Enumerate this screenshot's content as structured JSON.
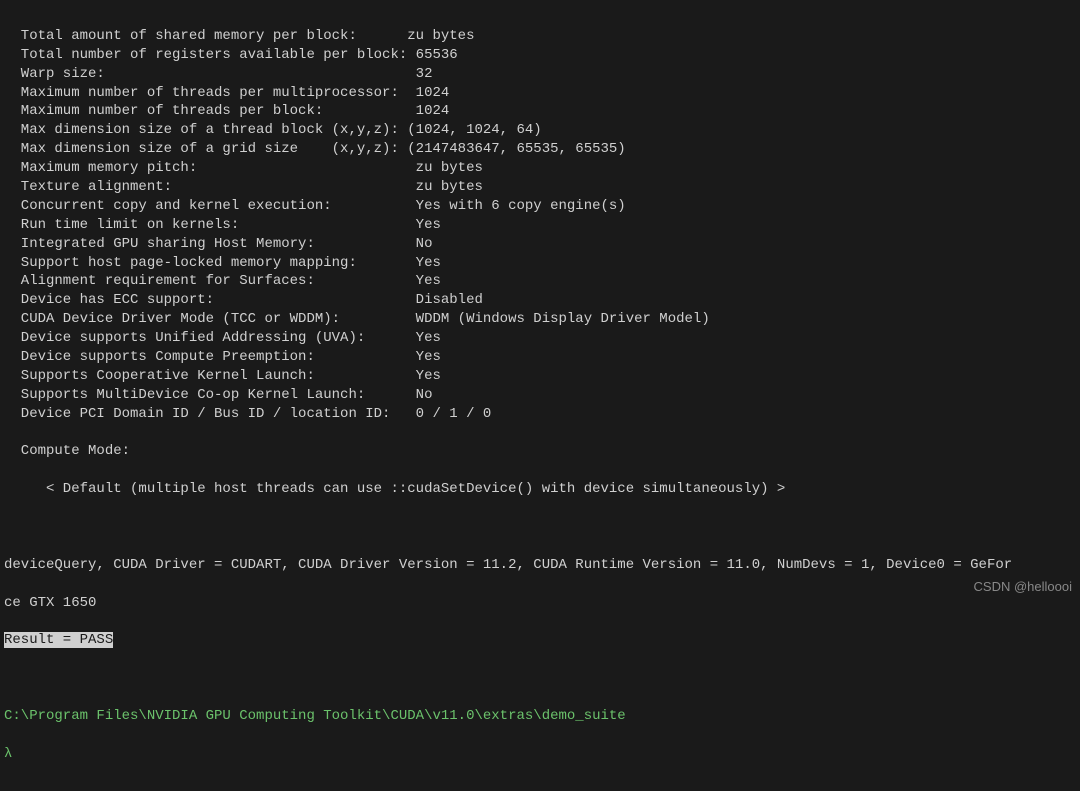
{
  "rows": [
    {
      "label": "  Total amount of shared memory per block:      ",
      "value": "zu bytes"
    },
    {
      "label": "  Total number of registers available per block: ",
      "value": "65536"
    },
    {
      "label": "  Warp size:                                     ",
      "value": "32"
    },
    {
      "label": "  Maximum number of threads per multiprocessor:  ",
      "value": "1024"
    },
    {
      "label": "  Maximum number of threads per block:           ",
      "value": "1024"
    },
    {
      "label": "  Max dimension size of a thread block (x,y,z): ",
      "value": "(1024, 1024, 64)"
    },
    {
      "label": "  Max dimension size of a grid size    (x,y,z): ",
      "value": "(2147483647, 65535, 65535)"
    },
    {
      "label": "  Maximum memory pitch:                          ",
      "value": "zu bytes"
    },
    {
      "label": "  Texture alignment:                             ",
      "value": "zu bytes"
    },
    {
      "label": "  Concurrent copy and kernel execution:          ",
      "value": "Yes with 6 copy engine(s)"
    },
    {
      "label": "  Run time limit on kernels:                     ",
      "value": "Yes"
    },
    {
      "label": "  Integrated GPU sharing Host Memory:            ",
      "value": "No"
    },
    {
      "label": "  Support host page-locked memory mapping:       ",
      "value": "Yes"
    },
    {
      "label": "  Alignment requirement for Surfaces:            ",
      "value": "Yes"
    },
    {
      "label": "  Device has ECC support:                        ",
      "value": "Disabled"
    },
    {
      "label": "  CUDA Device Driver Mode (TCC or WDDM):         ",
      "value": "WDDM (Windows Display Driver Model)"
    },
    {
      "label": "  Device supports Unified Addressing (UVA):      ",
      "value": "Yes"
    },
    {
      "label": "  Device supports Compute Preemption:            ",
      "value": "Yes"
    },
    {
      "label": "  Supports Cooperative Kernel Launch:            ",
      "value": "Yes"
    },
    {
      "label": "  Supports MultiDevice Co-op Kernel Launch:      ",
      "value": "No"
    },
    {
      "label": "  Device PCI Domain ID / Bus ID / location ID:   ",
      "value": "0 / 1 / 0"
    }
  ],
  "compute_mode_label": "  Compute Mode:",
  "compute_mode_desc": "     < Default (multiple host threads can use ::cudaSetDevice() with device simultaneously) >",
  "summary_line1": "deviceQuery, CUDA Driver = CUDART, CUDA Driver Version = 11.2, CUDA Runtime Version = 11.0, NumDevs = 1, Device0 = GeFor",
  "summary_line2": "ce GTX 1650",
  "result": "Result = PASS",
  "prompt_path": "C:\\Program Files\\NVIDIA GPU Computing Toolkit\\CUDA\\v11.0\\extras\\demo_suite",
  "prompt_char": "λ",
  "watermark": "CSDN @helloooi"
}
